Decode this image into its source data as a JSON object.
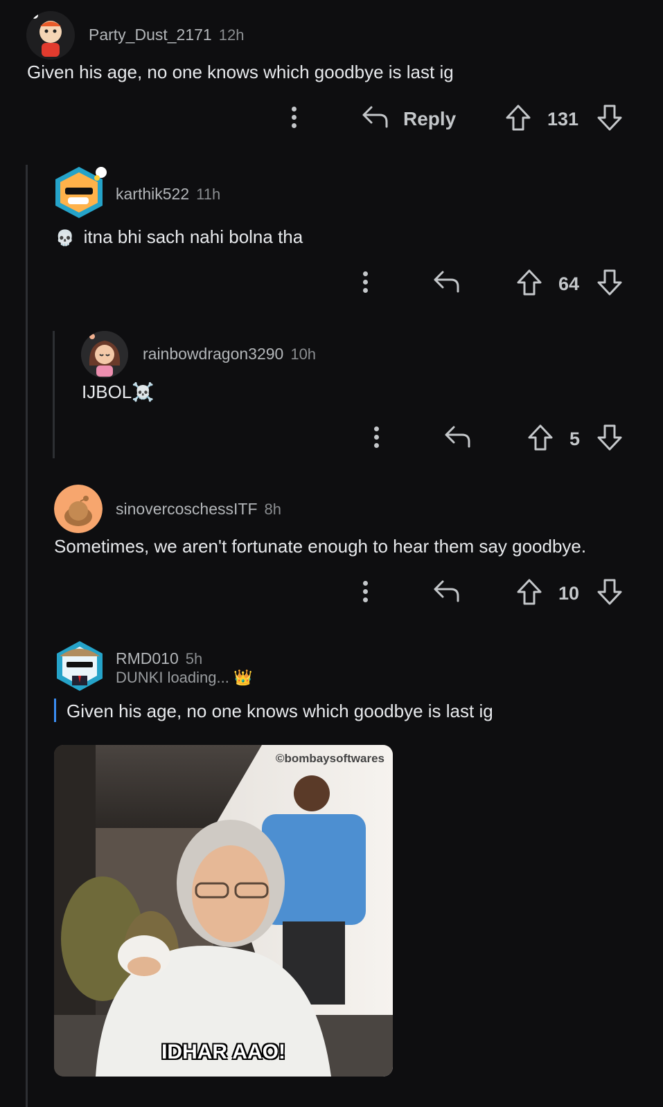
{
  "comments": [
    {
      "username": "Party_Dust_2171",
      "time": "12h",
      "text": "Given his age, no one knows which goodbye is last ig",
      "reply_label": "Reply",
      "score": "131"
    },
    {
      "username": "karthik522",
      "time": "11h",
      "emoji": "💀",
      "text": "itna bhi sach nahi bolna tha",
      "score": "64"
    },
    {
      "username": "rainbowdragon3290",
      "time": "10h",
      "text": "IJBOL☠️",
      "score": "5"
    },
    {
      "username": "sinovercoschessITF",
      "time": "8h",
      "text": "Sometimes, we aren't fortunate enough to hear them say goodbye.",
      "score": "10"
    },
    {
      "username": "RMD010",
      "time": "5h",
      "flair": "DUNKI loading... 👑",
      "quote": "Given his age, no one knows which goodbye is last ig"
    }
  ],
  "gif": {
    "watermark": "©bombaysoftwares",
    "caption": "IDHAR AAO!"
  }
}
